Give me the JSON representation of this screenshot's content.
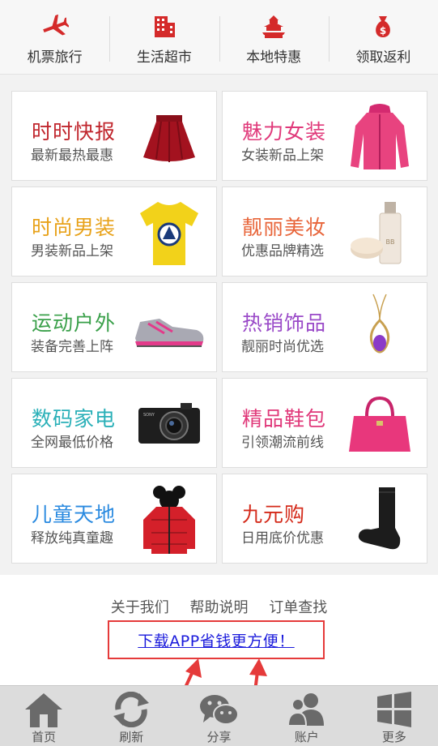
{
  "topnav": [
    {
      "label": "机票旅行",
      "icon": "airplane-icon"
    },
    {
      "label": "生活超市",
      "icon": "building-icon"
    },
    {
      "label": "本地特惠",
      "icon": "temple-icon"
    },
    {
      "label": "领取返利",
      "icon": "money-bag-icon"
    }
  ],
  "colors": {
    "accent_red": "#d42a2a",
    "link_blue": "#1a1adc",
    "highlight_border": "#e53a3a"
  },
  "categories": [
    {
      "title": "时时快报",
      "subtitle": "最新最热最惠",
      "color": "#c0262d",
      "image": "red-skirt"
    },
    {
      "title": "魅力女装",
      "subtitle": "女装新品上架",
      "color": "#e0397a",
      "image": "pink-hoodie"
    },
    {
      "title": "时尚男装",
      "subtitle": "男装新品上架",
      "color": "#e8a21a",
      "image": "yellow-tshirt"
    },
    {
      "title": "靓丽美妆",
      "subtitle": "优惠品牌精选",
      "color": "#e8653a",
      "image": "cosmetics-bottle"
    },
    {
      "title": "运动户外",
      "subtitle": "装备完善上阵",
      "color": "#3aa04a",
      "image": "sneaker"
    },
    {
      "title": "热销饰品",
      "subtitle": "靓丽时尚优选",
      "color": "#9a4ac8",
      "image": "pendant-necklace"
    },
    {
      "title": "数码家电",
      "subtitle": "全网最低价格",
      "color": "#2ab0b8",
      "image": "digital-camera"
    },
    {
      "title": "精品鞋包",
      "subtitle": "引领潮流前线",
      "color": "#e0397a",
      "image": "pink-handbag"
    },
    {
      "title": "儿童天地",
      "subtitle": "释放纯真童趣",
      "color": "#2a8ae0",
      "image": "kids-jacket"
    },
    {
      "title": "九元购",
      "subtitle": "日用底价优惠",
      "color": "#d42a1a",
      "image": "black-sock"
    }
  ],
  "footer": {
    "links": [
      "关于我们",
      "帮助说明",
      "订单查找"
    ],
    "download_label": "下载APP省钱更方便！"
  },
  "tabbar": [
    {
      "label": "首页",
      "icon": "home-icon"
    },
    {
      "label": "刷新",
      "icon": "refresh-icon"
    },
    {
      "label": "分享",
      "icon": "wechat-icon"
    },
    {
      "label": "账户",
      "icon": "users-icon"
    },
    {
      "label": "更多",
      "icon": "windows-icon"
    }
  ]
}
